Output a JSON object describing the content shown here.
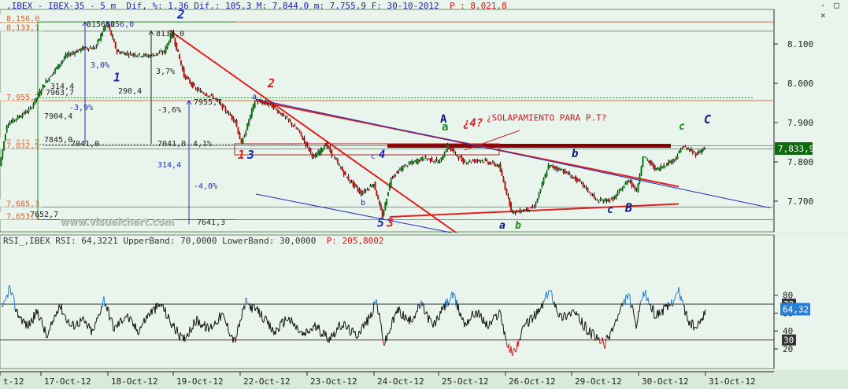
{
  "main_title": {
    "instrument": ",IBEX - IBEX-35 - 5 m",
    "stats": "Dif, %: 1,36 Dif.: 105,3 M: 7,844,0 m: 7,755,9 F: 30-10-2012",
    "p_label": "P : 8,021,8"
  },
  "window_controls": "- □ ×",
  "rsi_title": {
    "text": "RSI_,IBEX RSI: 64,3221 UpperBand: 70,0000 LowerBand: 30,0000",
    "p_label": "P: 205,8002"
  },
  "watermark": "www.visualchart.com",
  "current_price_label": "7,833,9",
  "rsi_current_label": "64,32",
  "rsi_band_labels": [
    "70",
    "30"
  ],
  "colors": {
    "candle_up": "#0a7a10",
    "candle_down": "#c01010",
    "trend_red": "#e02020",
    "channel_blue": "#2030c0",
    "zone_dark": "#8b0000",
    "price_box": "#0e6a0e",
    "rsi_box": "#2a7fd0"
  },
  "chart_data": [
    {
      "type": "candlestick",
      "title": ",IBEX - IBEX-35 - 5 m",
      "y_ticks": [
        "8.100",
        "8.000",
        "7.900",
        "7.800",
        "7.700"
      ],
      "ylim": [
        7620,
        8165
      ],
      "x_ticks": [
        "t-12",
        "17-Oct-12",
        "18-Oct-12",
        "19-Oct-12",
        "22-Oct-12",
        "23-Oct-12",
        "24-Oct-12",
        "25-Oct-12",
        "26-Oct-12",
        "29-Oct-12",
        "30-Oct-12",
        "31-Oct-12"
      ],
      "series": [
        {
          "name": "IBEX",
          "key_points": [
            {
              "x": 1,
              "y": 7790
            },
            {
              "x": 10,
              "y": 7895
            },
            {
              "x": 40,
              "y": 7935
            },
            {
              "x": 58,
              "y": 8000
            },
            {
              "x": 85,
              "y": 8070
            },
            {
              "x": 108,
              "y": 8090
            },
            {
              "x": 122,
              "y": 8090
            },
            {
              "x": 137,
              "y": 8155
            },
            {
              "x": 150,
              "y": 8080
            },
            {
              "x": 165,
              "y": 8075
            },
            {
              "x": 190,
              "y": 8070
            },
            {
              "x": 210,
              "y": 8080
            },
            {
              "x": 220,
              "y": 8130
            },
            {
              "x": 235,
              "y": 8020
            },
            {
              "x": 250,
              "y": 7985
            },
            {
              "x": 272,
              "y": 7965
            },
            {
              "x": 300,
              "y": 7905
            },
            {
              "x": 308,
              "y": 7845
            },
            {
              "x": 325,
              "y": 7955
            },
            {
              "x": 345,
              "y": 7945
            },
            {
              "x": 360,
              "y": 7920
            },
            {
              "x": 380,
              "y": 7880
            },
            {
              "x": 400,
              "y": 7810
            },
            {
              "x": 415,
              "y": 7845
            },
            {
              "x": 440,
              "y": 7765
            },
            {
              "x": 460,
              "y": 7720
            },
            {
              "x": 476,
              "y": 7745
            },
            {
              "x": 487,
              "y": 7660
            },
            {
              "x": 498,
              "y": 7760
            },
            {
              "x": 515,
              "y": 7790
            },
            {
              "x": 540,
              "y": 7810
            },
            {
              "x": 560,
              "y": 7800
            },
            {
              "x": 570,
              "y": 7840
            },
            {
              "x": 590,
              "y": 7800
            },
            {
              "x": 612,
              "y": 7805
            },
            {
              "x": 635,
              "y": 7790
            },
            {
              "x": 645,
              "y": 7720
            },
            {
              "x": 652,
              "y": 7670
            },
            {
              "x": 680,
              "y": 7685
            },
            {
              "x": 698,
              "y": 7790
            },
            {
              "x": 715,
              "y": 7780
            },
            {
              "x": 740,
              "y": 7745
            },
            {
              "x": 760,
              "y": 7700
            },
            {
              "x": 780,
              "y": 7705
            },
            {
              "x": 800,
              "y": 7755
            },
            {
              "x": 810,
              "y": 7725
            },
            {
              "x": 818,
              "y": 7815
            },
            {
              "x": 835,
              "y": 7780
            },
            {
              "x": 860,
              "y": 7810
            },
            {
              "x": 868,
              "y": 7840
            },
            {
              "x": 885,
              "y": 7820
            },
            {
              "x": 896,
              "y": 7835
            }
          ]
        }
      ],
      "horizontal_levels": [
        {
          "label": "8,156,0",
          "y": 8156
        },
        {
          "label": "8,133,1",
          "y": 8133
        },
        {
          "label": "7,955,7",
          "y": 7956
        },
        {
          "label": "7,840,7",
          "y": 7841
        },
        {
          "label": "7,832,5",
          "y": 7833
        },
        {
          "label": "7,685,3",
          "y": 7685
        },
        {
          "label": "7,653,3",
          "y": 7653
        }
      ],
      "measurement_labels": [
        {
          "text": "8156,0",
          "y": 8156
        },
        {
          "text": "8156,0",
          "y": 8156
        },
        {
          "text": "8133,0",
          "y": 8133
        },
        {
          "text": "314,4",
          "y": 7994
        },
        {
          "text": "7963,7",
          "y": 7964
        },
        {
          "text": "290,4",
          "y": 7988
        },
        {
          "text": "-3,9%",
          "y": 7940
        },
        {
          "text": "7955,7",
          "y": 7955
        },
        {
          "text": "-3,6%",
          "y": 7930
        },
        {
          "text": "7904,4",
          "y": 7904
        },
        {
          "text": "7845,0",
          "y": 7845
        },
        {
          "text": "7041,0",
          "y": 7845
        },
        {
          "text": "7041,0",
          "y": 7845
        },
        {
          "text": "4,1%",
          "y": 7845
        },
        {
          "text": "314,4",
          "y": 7790
        },
        {
          "text": "-4,0%",
          "y": 7740
        },
        {
          "text": "7652,7",
          "y": 7653
        },
        {
          "text": "7641,3",
          "y": 7641
        },
        {
          "text": "3,0%",
          "y": 8070
        },
        {
          "text": "3,7%",
          "y": 8030
        }
      ],
      "annotations": [
        {
          "text": "2",
          "x": 225,
          "y": 8165
        },
        {
          "text": "1",
          "x": 144,
          "y": 8005
        },
        {
          "text": "2",
          "x": 340,
          "y": 7990
        },
        {
          "text": "1",
          "x": 302,
          "y": 7808
        },
        {
          "text": "3",
          "x": 314,
          "y": 7808
        },
        {
          "text": "a",
          "x": 320,
          "y": 7960
        },
        {
          "text": "c",
          "x": 471,
          "y": 7808
        },
        {
          "text": "4",
          "x": 481,
          "y": 7810
        },
        {
          "text": "b",
          "x": 458,
          "y": 7690
        },
        {
          "text": "5",
          "x": 479,
          "y": 7635
        },
        {
          "text": "3",
          "x": 491,
          "y": 7635
        },
        {
          "text": "A",
          "x": 559,
          "y": 7900
        },
        {
          "text": "a",
          "x": 561,
          "y": 7880
        },
        {
          "text": "¿4?",
          "x": 588,
          "y": 7890
        },
        {
          "text": "¿SOLAPAMIENTO PARA P.T?",
          "x": 618,
          "y": 7905
        },
        {
          "text": "a",
          "x": 634,
          "y": 7630
        },
        {
          "text": "b",
          "x": 654,
          "y": 7630
        },
        {
          "text": "b",
          "x": 726,
          "y": 7812
        },
        {
          "text": "c",
          "x": 771,
          "y": 7670
        },
        {
          "text": "B",
          "x": 794,
          "y": 7673
        },
        {
          "text": "c",
          "x": 862,
          "y": 7882
        },
        {
          "text": "C",
          "x": 894,
          "y": 7898
        }
      ],
      "trend_lines": [
        {
          "color": "red",
          "from": [
            215,
            8135
          ],
          "to": [
            582,
            7616
          ]
        },
        {
          "color": "red",
          "from": [
            325,
            7956
          ],
          "to": [
            862,
            7737
          ]
        },
        {
          "color": "red",
          "from": [
            495,
            7660
          ],
          "to": [
            862,
            7693
          ]
        },
        {
          "color": "blue",
          "from": [
            325,
            7960
          ],
          "to": [
            978,
            7683
          ]
        },
        {
          "color": "blue",
          "from": [
            325,
            7718
          ],
          "to": [
            578,
            7618
          ]
        }
      ]
    },
    {
      "type": "line",
      "title": "RSI_,IBEX RSI",
      "y_ticks": [
        "80",
        "60",
        "40",
        "20"
      ],
      "ylim": [
        10,
        95
      ],
      "upper_band": 70,
      "lower_band": 30,
      "series": [
        {
          "name": "RSI",
          "key_points": [
            {
              "x": 3,
              "y": 62
            },
            {
              "x": 12,
              "y": 88
            },
            {
              "x": 22,
              "y": 60
            },
            {
              "x": 35,
              "y": 45
            },
            {
              "x": 48,
              "y": 62
            },
            {
              "x": 60,
              "y": 32
            },
            {
              "x": 75,
              "y": 70
            },
            {
              "x": 90,
              "y": 45
            },
            {
              "x": 105,
              "y": 52
            },
            {
              "x": 118,
              "y": 38
            },
            {
              "x": 132,
              "y": 76
            },
            {
              "x": 145,
              "y": 42
            },
            {
              "x": 160,
              "y": 58
            },
            {
              "x": 175,
              "y": 40
            },
            {
              "x": 190,
              "y": 60
            },
            {
              "x": 205,
              "y": 70
            },
            {
              "x": 215,
              "y": 52
            },
            {
              "x": 232,
              "y": 30
            },
            {
              "x": 250,
              "y": 52
            },
            {
              "x": 265,
              "y": 42
            },
            {
              "x": 282,
              "y": 58
            },
            {
              "x": 298,
              "y": 28
            },
            {
              "x": 312,
              "y": 72
            },
            {
              "x": 330,
              "y": 60
            },
            {
              "x": 348,
              "y": 38
            },
            {
              "x": 365,
              "y": 55
            },
            {
              "x": 385,
              "y": 35
            },
            {
              "x": 400,
              "y": 45
            },
            {
              "x": 418,
              "y": 32
            },
            {
              "x": 435,
              "y": 48
            },
            {
              "x": 452,
              "y": 35
            },
            {
              "x": 470,
              "y": 55
            },
            {
              "x": 478,
              "y": 74
            },
            {
              "x": 488,
              "y": 25
            },
            {
              "x": 505,
              "y": 64
            },
            {
              "x": 520,
              "y": 50
            },
            {
              "x": 535,
              "y": 70
            },
            {
              "x": 550,
              "y": 45
            },
            {
              "x": 565,
              "y": 68
            },
            {
              "x": 575,
              "y": 80
            },
            {
              "x": 590,
              "y": 48
            },
            {
              "x": 605,
              "y": 62
            },
            {
              "x": 620,
              "y": 45
            },
            {
              "x": 635,
              "y": 62
            },
            {
              "x": 645,
              "y": 22
            },
            {
              "x": 652,
              "y": 15
            },
            {
              "x": 668,
              "y": 48
            },
            {
              "x": 685,
              "y": 62
            },
            {
              "x": 698,
              "y": 86
            },
            {
              "x": 712,
              "y": 55
            },
            {
              "x": 728,
              "y": 62
            },
            {
              "x": 745,
              "y": 42
            },
            {
              "x": 760,
              "y": 30
            },
            {
              "x": 768,
              "y": 25
            },
            {
              "x": 782,
              "y": 50
            },
            {
              "x": 798,
              "y": 82
            },
            {
              "x": 808,
              "y": 45
            },
            {
              "x": 818,
              "y": 84
            },
            {
              "x": 832,
              "y": 58
            },
            {
              "x": 848,
              "y": 66
            },
            {
              "x": 862,
              "y": 84
            },
            {
              "x": 875,
              "y": 50
            },
            {
              "x": 885,
              "y": 42
            },
            {
              "x": 896,
              "y": 64
            }
          ]
        }
      ]
    }
  ]
}
